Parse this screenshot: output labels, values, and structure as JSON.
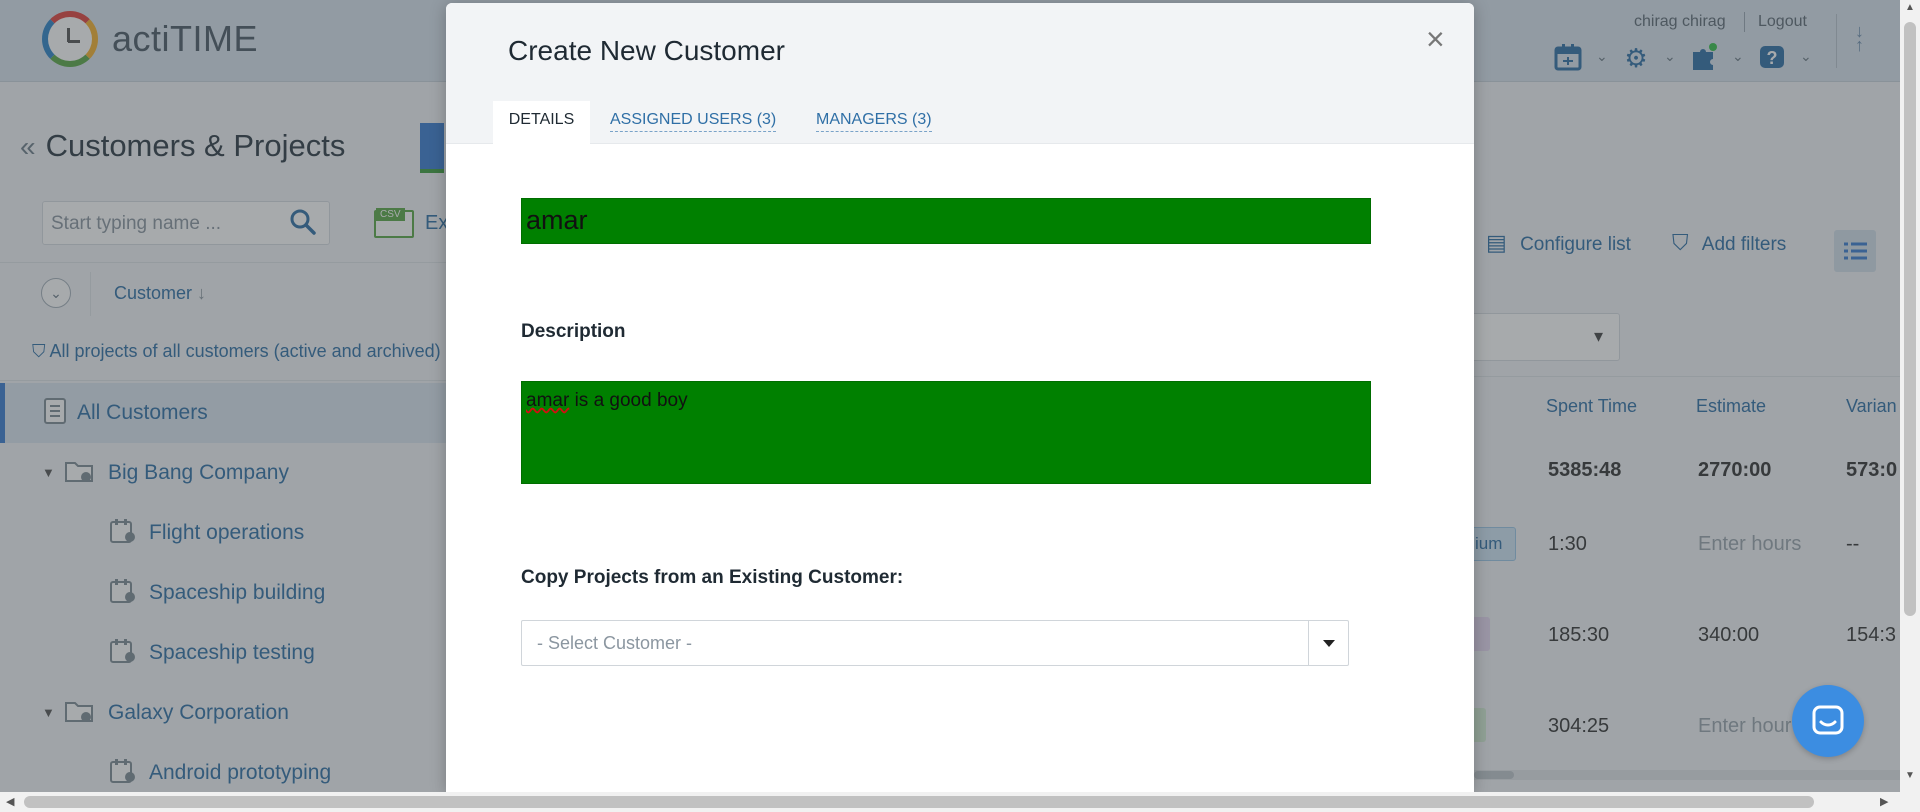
{
  "header": {
    "brand": "actiTIME",
    "user": "chirag chirag",
    "logout": "Logout"
  },
  "page": {
    "title": "Customers & Projects",
    "search_placeholder": "Start typing name ...",
    "csv_badge": "CSV",
    "export_label": "Ex",
    "column_customer": "Customer",
    "filter_text": "All projects of all customers (active and archived)",
    "configure_list": "Configure list",
    "add_filters": "Add filters"
  },
  "tree": {
    "all_customers": "All Customers",
    "items": [
      {
        "label": "Big Bang Company"
      },
      {
        "label": "Flight operations"
      },
      {
        "label": "Spaceship building"
      },
      {
        "label": "Spaceship testing"
      },
      {
        "label": "Galaxy Corporation"
      },
      {
        "label": "Android prototyping"
      }
    ]
  },
  "table": {
    "columns": [
      "Spent Time",
      "Estimate",
      "Varian"
    ],
    "summary": [
      "5385:48",
      "2770:00",
      "573:0"
    ],
    "rows": [
      {
        "badge": "ium",
        "spent": "1:30",
        "estimate": "Enter hours",
        "variance": "--"
      },
      {
        "badge": "",
        "spent": "185:30",
        "estimate": "340:00",
        "variance": "154:3"
      },
      {
        "badge": "",
        "spent": "304:25",
        "estimate": "Enter hour",
        "variance": ""
      }
    ]
  },
  "modal": {
    "title": "Create New Customer",
    "close": "×",
    "tabs": {
      "details": "DETAILS",
      "assigned_users": "ASSIGNED USERS (3)",
      "managers": "MANAGERS (3)"
    },
    "name_value": "amar",
    "description_label": "Description",
    "description_word1": "amar",
    "description_rest": " is a good boy",
    "copy_label": "Copy Projects from an Existing Customer:",
    "select_placeholder": "- Select Customer -"
  },
  "colors": {
    "field_bg": "#008000",
    "accent": "#2f6fa6",
    "chat": "#3c8de1"
  }
}
